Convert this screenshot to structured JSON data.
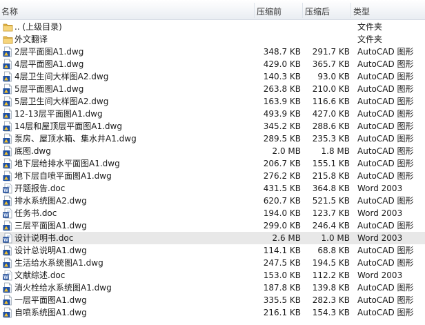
{
  "columns": {
    "name": "名称",
    "before": "压缩前",
    "after": "压缩后",
    "type": "类型"
  },
  "rows": [
    {
      "name": ".. (上级目录)",
      "before": "",
      "after": "",
      "type": "文件夹",
      "icon": "folder-icon"
    },
    {
      "name": "外文翻译",
      "before": "",
      "after": "",
      "type": "文件夹",
      "icon": "folder-icon"
    },
    {
      "name": "2层平面图A1.dwg",
      "before": "348.7 KB",
      "after": "291.7 KB",
      "type": "AutoCAD 图形",
      "icon": "autocad-file-icon"
    },
    {
      "name": "4层平面图A1.dwg",
      "before": "429.0 KB",
      "after": "365.7 KB",
      "type": "AutoCAD 图形",
      "icon": "autocad-file-icon"
    },
    {
      "name": "4层卫生间大样图A2.dwg",
      "before": "140.3 KB",
      "after": "93.0 KB",
      "type": "AutoCAD 图形",
      "icon": "autocad-file-icon"
    },
    {
      "name": "5层平面图A1.dwg",
      "before": "263.8 KB",
      "after": "210.0 KB",
      "type": "AutoCAD 图形",
      "icon": "autocad-file-icon"
    },
    {
      "name": "5层卫生间大样图A2.dwg",
      "before": "163.9 KB",
      "after": "116.6 KB",
      "type": "AutoCAD 图形",
      "icon": "autocad-file-icon"
    },
    {
      "name": "12-13层平面图A1.dwg",
      "before": "493.9 KB",
      "after": "427.0 KB",
      "type": "AutoCAD 图形",
      "icon": "autocad-file-icon"
    },
    {
      "name": "14层和屋顶层平面图A1.dwg",
      "before": "345.2 KB",
      "after": "288.6 KB",
      "type": "AutoCAD 图形",
      "icon": "autocad-file-icon"
    },
    {
      "name": "泵房、屋顶水箱、集水井A1.dwg",
      "before": "289.5 KB",
      "after": "235.3 KB",
      "type": "AutoCAD 图形",
      "icon": "autocad-file-icon"
    },
    {
      "name": "底图.dwg",
      "before": "2.0 MB",
      "after": "1.8 MB",
      "type": "AutoCAD 图形",
      "icon": "autocad-file-icon"
    },
    {
      "name": "地下层给排水平面图A1.dwg",
      "before": "206.7 KB",
      "after": "155.1 KB",
      "type": "AutoCAD 图形",
      "icon": "autocad-file-icon"
    },
    {
      "name": "地下层自喷平面图A1.dwg",
      "before": "276.2 KB",
      "after": "215.8 KB",
      "type": "AutoCAD 图形",
      "icon": "autocad-file-icon"
    },
    {
      "name": "开题报告.doc",
      "before": "431.5 KB",
      "after": "364.8 KB",
      "type": "Word 2003",
      "icon": "word-document-icon"
    },
    {
      "name": "排水系统图A2.dwg",
      "before": "620.7 KB",
      "after": "521.5 KB",
      "type": "AutoCAD 图形",
      "icon": "autocad-file-icon"
    },
    {
      "name": "任务书.doc",
      "before": "194.0 KB",
      "after": "123.7 KB",
      "type": "Word 2003",
      "icon": "word-document-icon"
    },
    {
      "name": "三层平面图A1.dwg",
      "before": "299.0 KB",
      "after": "246.4 KB",
      "type": "AutoCAD 图形",
      "icon": "autocad-file-icon"
    },
    {
      "name": "设计说明书.doc",
      "before": "2.6 MB",
      "after": "1.0 MB",
      "type": "Word 2003",
      "icon": "word-document-icon",
      "selected": true
    },
    {
      "name": "设计总说明A1.dwg",
      "before": "114.1 KB",
      "after": "68.8 KB",
      "type": "AutoCAD 图形",
      "icon": "autocad-file-icon"
    },
    {
      "name": "生活给水系统图A1.dwg",
      "before": "247.5 KB",
      "after": "194.5 KB",
      "type": "AutoCAD 图形",
      "icon": "autocad-file-icon"
    },
    {
      "name": "文献综述.doc",
      "before": "153.0 KB",
      "after": "112.2 KB",
      "type": "Word 2003",
      "icon": "word-document-icon"
    },
    {
      "name": "消火栓给水系统图A1.dwg",
      "before": "187.8 KB",
      "after": "139.8 KB",
      "type": "AutoCAD 图形",
      "icon": "autocad-file-icon"
    },
    {
      "name": "一层平面图A1.dwg",
      "before": "335.5 KB",
      "after": "282.3 KB",
      "type": "AutoCAD 图形",
      "icon": "autocad-file-icon"
    },
    {
      "name": "自喷系统图A1.dwg",
      "before": "216.1 KB",
      "after": "154.3 KB",
      "type": "AutoCAD 图形",
      "icon": "autocad-file-icon"
    }
  ]
}
